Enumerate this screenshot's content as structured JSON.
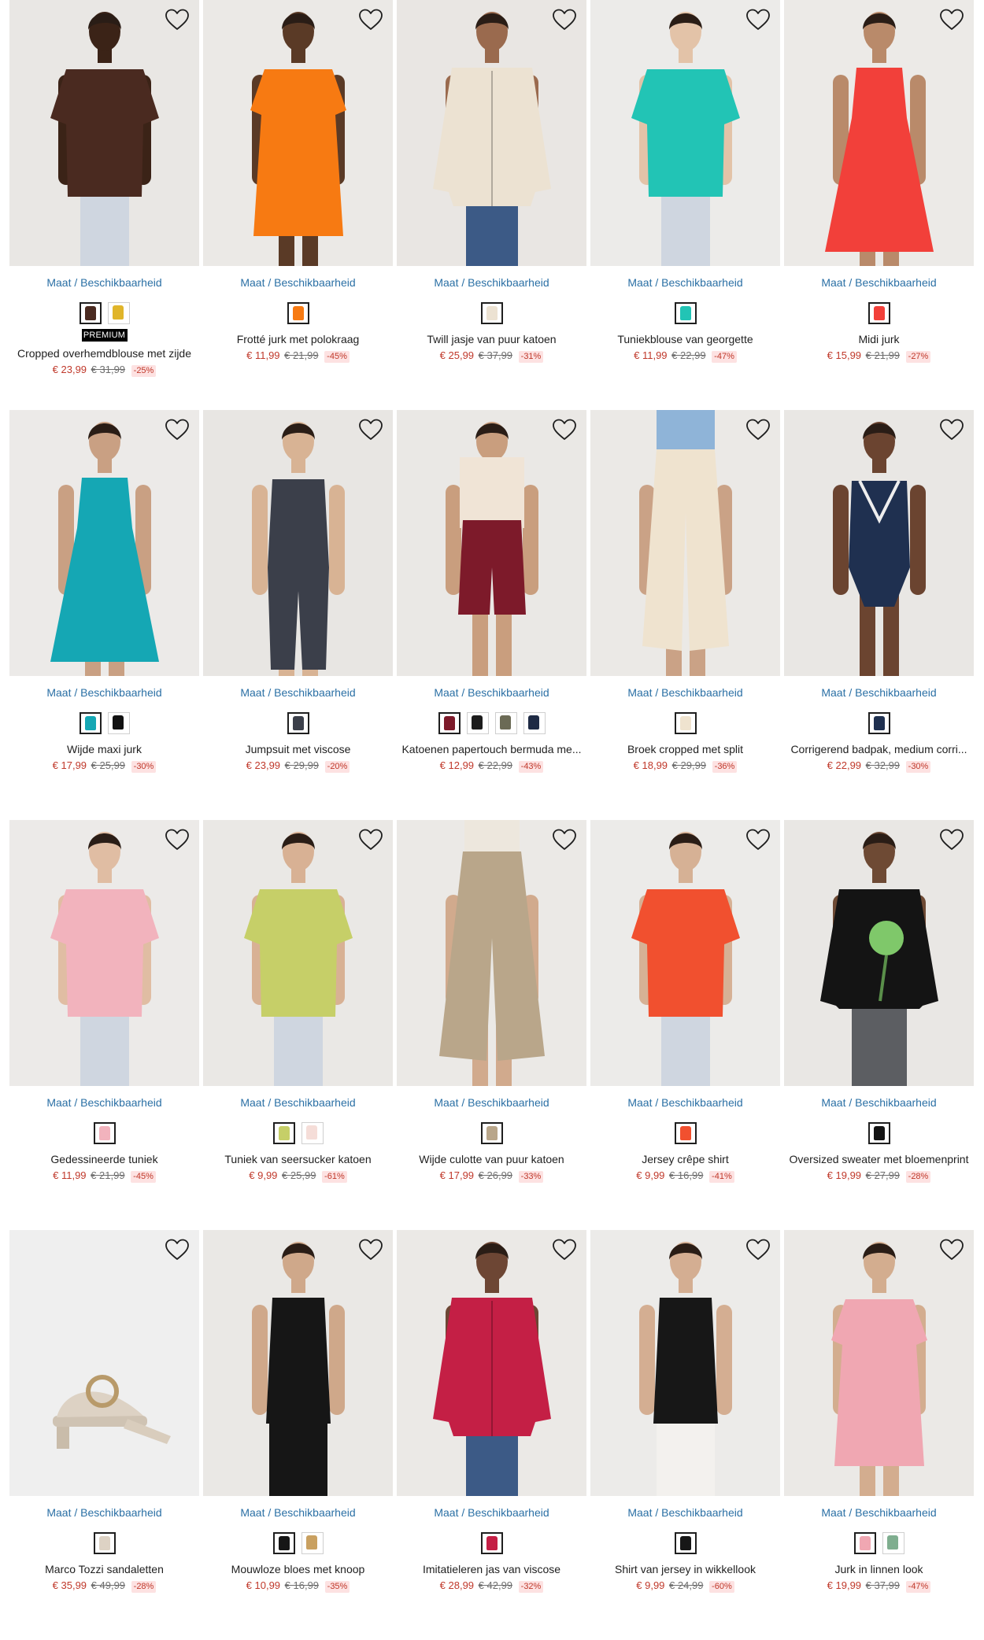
{
  "common": {
    "size_label": "Maat / Beschikbaarheid",
    "premium_label": "PREMIUM",
    "heart_icon": "heart-outline-icon"
  },
  "products": [
    {
      "title": "Cropped overhemdblouse met zijde",
      "price": "€ 23,99",
      "old_price": "€ 31,99",
      "discount": "-25%",
      "premium": true,
      "bg": "#e9e7e4",
      "garment": "#4a2a20",
      "skin": "#3b2317",
      "shape": "top",
      "swatches": [
        "#4a2a20",
        "#e0b52a"
      ]
    },
    {
      "title": "Frotté jurk met polokraag",
      "price": "€ 11,99",
      "old_price": "€ 21,99",
      "discount": "-45%",
      "premium": false,
      "bg": "#ebe9e6",
      "garment": "#f77a12",
      "skin": "#5a3a26",
      "shape": "dress",
      "swatches": [
        "#f77a12"
      ]
    },
    {
      "title": "Twill jasje van puur katoen",
      "price": "€ 25,99",
      "old_price": "€ 37,99",
      "discount": "-31%",
      "premium": false,
      "bg": "#e9e6e3",
      "garment": "#ece2d2",
      "skin": "#9a6a4e",
      "shape": "jacket",
      "swatches": [
        "#ece2d2"
      ]
    },
    {
      "title": "Tuniekblouse van georgette",
      "price": "€ 11,99",
      "old_price": "€ 22,99",
      "discount": "-47%",
      "premium": false,
      "bg": "#ecebe9",
      "garment": "#22c4b5",
      "skin": "#e3c3a8",
      "shape": "top",
      "swatches": [
        "#22c4b5"
      ]
    },
    {
      "title": "Midi jurk",
      "price": "€ 15,99",
      "old_price": "€ 21,99",
      "discount": "-27%",
      "premium": false,
      "bg": "#eceae7",
      "garment": "#f2403a",
      "skin": "#b98a6a",
      "shape": "longdress",
      "swatches": [
        "#f2403a"
      ]
    },
    {
      "title": "Wijde maxi jurk",
      "price": "€ 17,99",
      "old_price": "€ 25,99",
      "discount": "-30%",
      "premium": false,
      "bg": "#eceae8",
      "garment": "#15a7b4",
      "skin": "#c9a083",
      "shape": "longdress",
      "swatches": [
        "#15a7b4",
        "#111111"
      ]
    },
    {
      "title": "Jumpsuit met viscose",
      "price": "€ 23,99",
      "old_price": "€ 29,99",
      "discount": "-20%",
      "premium": false,
      "bg": "#e8e6e3",
      "garment": "#3b3f4a",
      "skin": "#d8b394",
      "shape": "jumpsuit",
      "swatches": [
        "#3b3f4a"
      ]
    },
    {
      "title": "Katoenen papertouch bermuda me...",
      "price": "€ 12,99",
      "old_price": "€ 22,99",
      "discount": "-43%",
      "premium": false,
      "bg": "#eae8e5",
      "garment": "#7d1a2a",
      "skin": "#c99e7e",
      "shape": "shorts",
      "swatches": [
        "#7d1a2a",
        "#1c1c1c",
        "#6b6a55",
        "#1e2a44"
      ]
    },
    {
      "title": "Broek cropped met split",
      "price": "€ 18,99",
      "old_price": "€ 29,99",
      "discount": "-36%",
      "premium": false,
      "bg": "#ebe9e6",
      "garment": "#efe3cf",
      "skin": "#caa286",
      "shape": "trousers",
      "swatches": [
        "#efe3cf"
      ]
    },
    {
      "title": "Corrigerend badpak, medium corri...",
      "price": "€ 22,99",
      "old_price": "€ 32,99",
      "discount": "-30%",
      "premium": false,
      "bg": "#e9e7e4",
      "garment": "#1f3050",
      "skin": "#6b4430",
      "shape": "swimsuit",
      "swatches": [
        "#1f3050"
      ]
    },
    {
      "title": "Gedessineerde tuniek",
      "price": "€ 11,99",
      "old_price": "€ 21,99",
      "discount": "-45%",
      "premium": false,
      "bg": "#eceae8",
      "garment": "#f2b3bd",
      "skin": "#e0bda3",
      "shape": "top",
      "swatches": [
        "#f2b3bd"
      ]
    },
    {
      "title": "Tuniek van seersucker katoen",
      "price": "€ 9,99",
      "old_price": "€ 25,99",
      "discount": "-61%",
      "premium": false,
      "bg": "#eae8e5",
      "garment": "#c6cf68",
      "skin": "#d8b194",
      "shape": "top",
      "swatches": [
        "#c6cf68",
        "#f5ddd8"
      ]
    },
    {
      "title": "Wijde culotte van puur katoen",
      "price": "€ 17,99",
      "old_price": "€ 26,99",
      "discount": "-33%",
      "premium": false,
      "bg": "#ebe9e6",
      "garment": "#b9a68a",
      "skin": "#d1aa8d",
      "shape": "culotte",
      "swatches": [
        "#b9a68a"
      ]
    },
    {
      "title": "Jersey crêpe shirt",
      "price": "€ 9,99",
      "old_price": "€ 16,99",
      "discount": "-41%",
      "premium": false,
      "bg": "#ecebe9",
      "garment": "#f1502f",
      "skin": "#d6b195",
      "shape": "top",
      "swatches": [
        "#f1502f"
      ]
    },
    {
      "title": "Oversized sweater met bloemenprint",
      "price": "€ 19,99",
      "old_price": "€ 27,99",
      "discount": "-28%",
      "premium": false,
      "bg": "#e9e7e4",
      "garment": "#141414",
      "skin": "#6e4a34",
      "shape": "sweater",
      "swatches": [
        "#141414"
      ]
    },
    {
      "title": "Marco Tozzi sandaletten",
      "price": "€ 35,99",
      "old_price": "€ 49,99",
      "discount": "-28%",
      "premium": false,
      "bg": "#efefef",
      "garment": "#ddd2c4",
      "skin": "#ddd2c4",
      "shape": "sandal",
      "swatches": [
        "#ddd2c4"
      ]
    },
    {
      "title": "Mouwloze bloes met knoop",
      "price": "€ 10,99",
      "old_price": "€ 16,99",
      "discount": "-35%",
      "premium": false,
      "bg": "#eae8e5",
      "garment": "#161616",
      "skin": "#cfa88a",
      "shape": "sleeveless",
      "swatches": [
        "#161616",
        "#c9a060"
      ]
    },
    {
      "title": "Imitatieleren jas van viscose",
      "price": "€ 28,99",
      "old_price": "€ 42,99",
      "discount": "-32%",
      "premium": false,
      "bg": "#ebe9e6",
      "garment": "#c41f45",
      "skin": "#6d4634",
      "shape": "jacket",
      "swatches": [
        "#c41f45"
      ]
    },
    {
      "title": "Shirt van jersey in wikkellook",
      "price": "€ 9,99",
      "old_price": "€ 24,99",
      "discount": "-60%",
      "premium": false,
      "bg": "#ecebe9",
      "garment": "#171717",
      "skin": "#d4ae92",
      "shape": "sleeveless",
      "swatches": [
        "#171717"
      ]
    },
    {
      "title": "Jurk in linnen look",
      "price": "€ 19,99",
      "old_price": "€ 37,99",
      "discount": "-47%",
      "premium": false,
      "bg": "#ebe9e6",
      "garment": "#f0a7b2",
      "skin": "#d3ad8f",
      "shape": "dress",
      "swatches": [
        "#f0a7b2",
        "#7fae8f"
      ]
    }
  ]
}
